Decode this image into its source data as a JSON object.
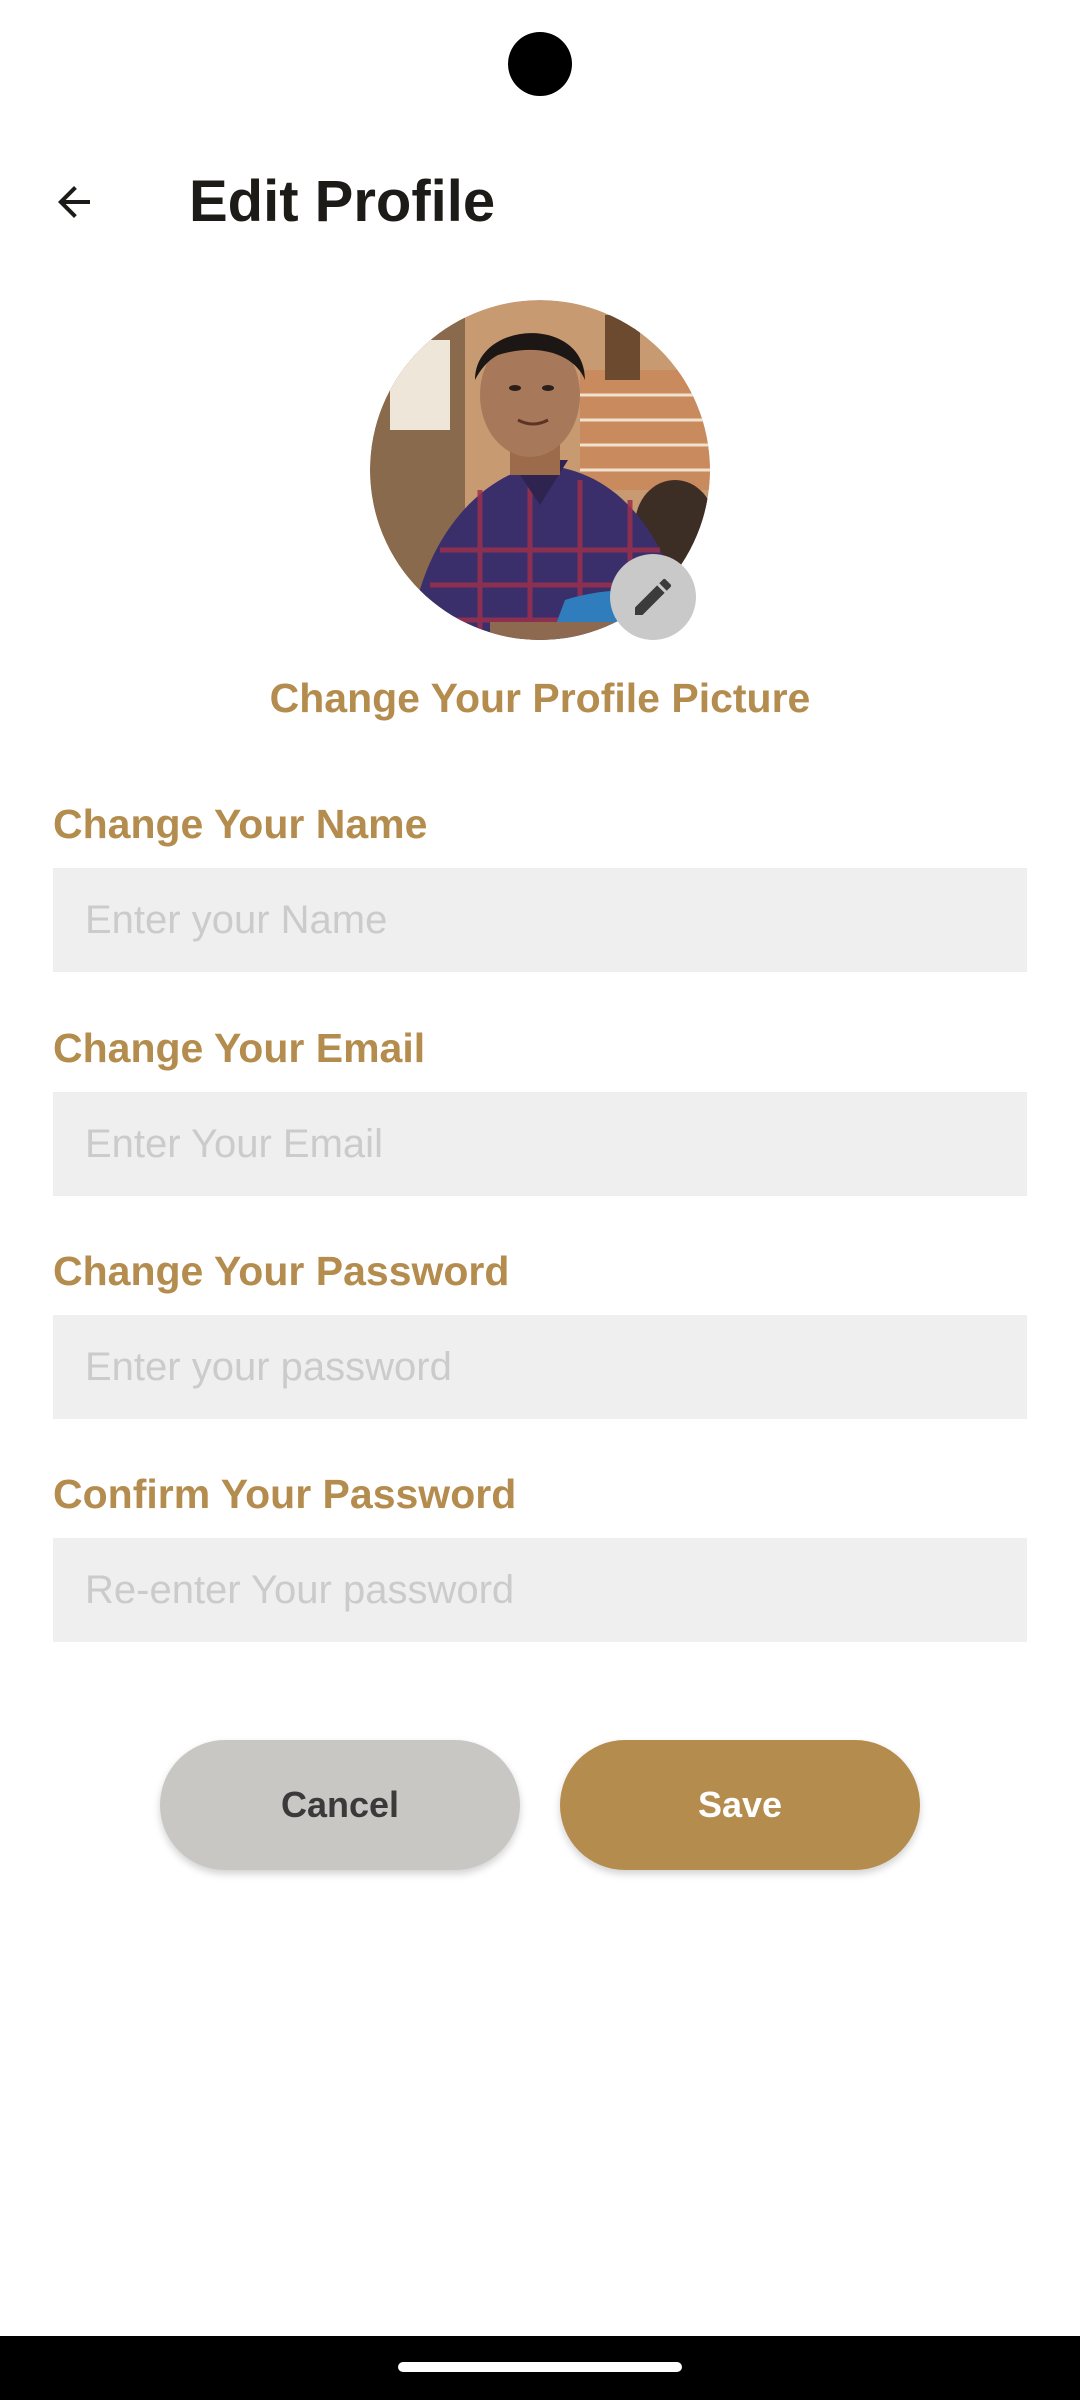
{
  "header": {
    "title": "Edit Profile",
    "back_icon": "arrow-left-icon"
  },
  "profile_picture": {
    "edit_icon": "pencil-icon",
    "change_label": "Change Your Profile Picture"
  },
  "form": {
    "name": {
      "label": "Change Your Name",
      "placeholder": "Enter your Name",
      "value": ""
    },
    "email": {
      "label": "Change Your Email",
      "placeholder": "Enter Your Email",
      "value": ""
    },
    "password": {
      "label": "Change Your Password",
      "placeholder": "Enter your password",
      "value": ""
    },
    "confirm_password": {
      "label": "Confirm Your Password",
      "placeholder": "Re-enter Your password",
      "value": ""
    }
  },
  "actions": {
    "cancel_label": "Cancel",
    "save_label": "Save"
  },
  "colors": {
    "accent": "#b48c4e",
    "input_background": "#efefef",
    "cancel_background": "#c8c7c4",
    "title_text": "#1d1b18"
  }
}
